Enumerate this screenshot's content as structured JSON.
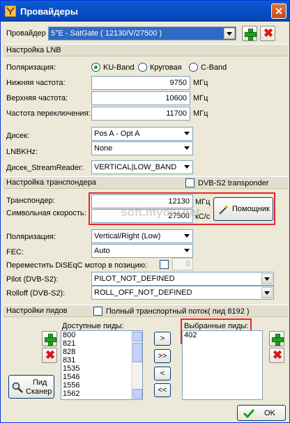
{
  "window": {
    "title": "Провайдеры",
    "close_label": "✕"
  },
  "provider": {
    "label": "Провайдер",
    "value": "5°E - SatGate ( 12130/V/27500 )"
  },
  "lnb": {
    "section": "Настройка LNB",
    "polarization_label": "Поляризация:",
    "radio_ku": "KU-Band",
    "radio_circular": "Круговая",
    "radio_c": "C-Band",
    "low_freq_label": "Нижняя частота:",
    "low_freq": "9750",
    "high_freq_label": "Верхняя частота:",
    "high_freq": "10600",
    "switch_freq_label": "Частота переключения:",
    "switch_freq": "11700",
    "unit_mhz": "МГц",
    "diseqc_label": "Дисек:",
    "diseqc_value": "Pos A - Opt A",
    "lnbkhz_label": "LNBKHz:",
    "lnbkhz_value": "None",
    "stream_label": "Дисек_StreamReader:",
    "stream_value": "VERTICAL|LOW_BAND"
  },
  "transponder": {
    "section": "Настройка транспондера",
    "dvbs2_label": "DVB-S2 transponder",
    "tp_label": "Транспондер:",
    "tp_value": "12130",
    "tp_unit": "МГц",
    "sr_label": "Символьная скорость:",
    "sr_value": "27500",
    "sr_unit": "кС/с",
    "helper_button": "Помощник",
    "polarization_label": "Поляризация:",
    "polarization_value": "Vertical/Right (Low)",
    "fec_label": "FEC:",
    "fec_value": "Auto",
    "move_label": "Переместить DiSEqC мотор в позицию:",
    "move_value": "0",
    "pilot_label": "Pilot (DVB-S2):",
    "pilot_value": "PILOT_NOT_DEFINED",
    "rolloff_label": "Rolloff (DVB-S2):",
    "rolloff_value": "ROLL_OFF_NOT_DEFINED"
  },
  "pids": {
    "section": "Настройки пидов",
    "full_ts_label": "Полный транспортный поток( пид 8192 )",
    "available_label": "Доступные пиды:",
    "available": [
      "800",
      "821",
      "828",
      "831",
      "1535",
      "1546",
      "1556",
      "1562"
    ],
    "selected_label": "Выбранные пиды:",
    "selected": [
      "402"
    ],
    "move_right": ">",
    "move_all_right": ">>",
    "move_left": "<",
    "move_all_left": "<<",
    "scanner_line1": "Пид",
    "scanner_line2": "Сканер"
  },
  "footer": {
    "ok_label": "OK"
  },
  "watermark": "soft.mydiv.net"
}
